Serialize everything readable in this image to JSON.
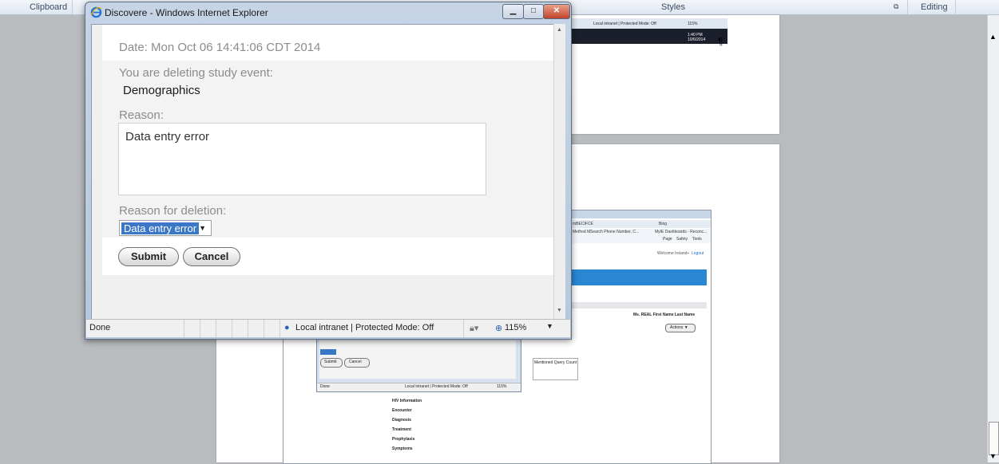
{
  "ribbon": {
    "clipboard": "Clipboard",
    "styles": "Styles",
    "editing": "Editing"
  },
  "ie": {
    "title": "Discovere - Windows Internet Explorer",
    "date_label": "Date: Mon Oct 06 14:41:06 CDT 2014",
    "deleting_label": "You are deleting study event:",
    "event_name": "Demographics",
    "reason_label": "Reason:",
    "reason_text": "Data entry error",
    "deletion_label": "Reason for deletion:",
    "deletion_value": "Data entry error",
    "submit": "Submit",
    "cancel": "Cancel",
    "status_done": "Done",
    "status_zone": "Local intranet | Protected Mode: Off",
    "zoom": "115%"
  },
  "embedded": {
    "top_status": "Local intranet | Protected Mode: Off",
    "top_zoom": "115%",
    "clock_time": "1:40 PM",
    "clock_date": "10/6/2014",
    "pilcrow": "¶",
    "addr_partial": "mBECIFCE",
    "search_engine": "Bing",
    "fav_method": "Method M",
    "fav_phone": "Search Phone Number, C...",
    "fav_dashboards": "MyIE Dashboards - Reconc...",
    "toolbar_page": "Page",
    "toolbar_safety": "Safety",
    "toolbar_tools": "Tools",
    "welcome": "Welcome Ireland+",
    "logout": "Logout",
    "patient": "Ms. REAL First Name Last Name",
    "actions": "Actions ▼",
    "query_col": "Mentioned Query Count",
    "mini_submit": "Submit",
    "mini_cancel": "Cancel",
    "mini_done": "Done",
    "mini_status": "Local intranet | Protected Mode: Off",
    "mini_zoom": "115%",
    "menu": [
      "HIV Information",
      "Encounter",
      "Diagnosis",
      "Treatment",
      "Prophylaxis",
      "Symptoms"
    ]
  }
}
